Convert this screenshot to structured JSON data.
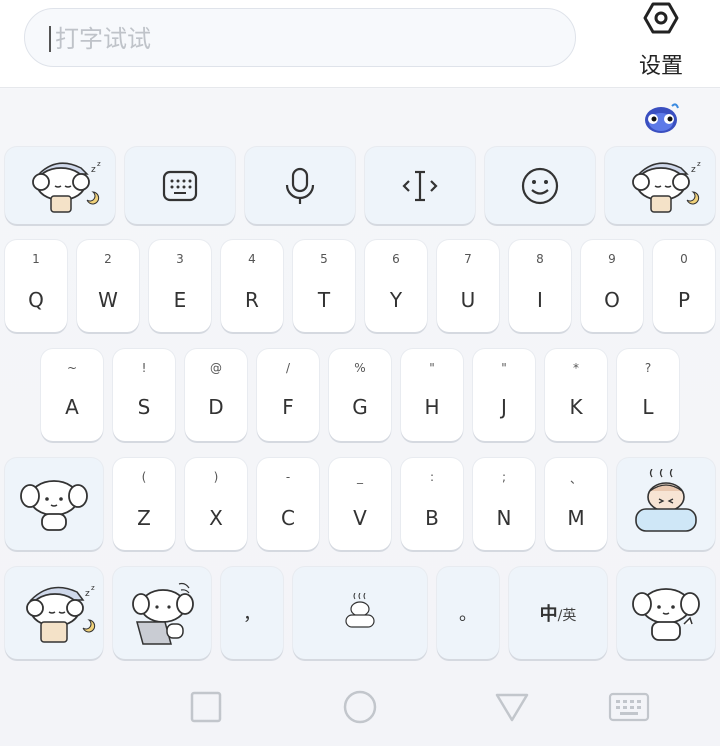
{
  "search": {
    "placeholder": "打字试试"
  },
  "settings": {
    "label": "设置"
  },
  "toolbar": {
    "keys": [
      {
        "name": "keyboard-icon"
      },
      {
        "name": "microphone-icon"
      },
      {
        "name": "cursor-move-icon"
      },
      {
        "name": "emoji-smile-icon"
      }
    ]
  },
  "row1": [
    {
      "sub": "1",
      "main": "Q"
    },
    {
      "sub": "2",
      "main": "W"
    },
    {
      "sub": "3",
      "main": "E"
    },
    {
      "sub": "4",
      "main": "R"
    },
    {
      "sub": "5",
      "main": "T"
    },
    {
      "sub": "6",
      "main": "Y"
    },
    {
      "sub": "7",
      "main": "U"
    },
    {
      "sub": "8",
      "main": "I"
    },
    {
      "sub": "9",
      "main": "O"
    },
    {
      "sub": "0",
      "main": "P"
    }
  ],
  "row2": [
    {
      "sub": "~",
      "main": "A"
    },
    {
      "sub": "!",
      "main": "S"
    },
    {
      "sub": "@",
      "main": "D"
    },
    {
      "sub": "/",
      "main": "F"
    },
    {
      "sub": "%",
      "main": "G"
    },
    {
      "sub": "\"",
      "main": "H"
    },
    {
      "sub": "\"",
      "main": "J"
    },
    {
      "sub": "*",
      "main": "K"
    },
    {
      "sub": "?",
      "main": "L"
    }
  ],
  "row3": [
    {
      "sub": "(",
      "main": "Z"
    },
    {
      "sub": ")",
      "main": "X"
    },
    {
      "sub": "-",
      "main": "C"
    },
    {
      "sub": "_",
      "main": "V"
    },
    {
      "sub": ":",
      "main": "B"
    },
    {
      "sub": ";",
      "main": "N"
    },
    {
      "sub": "、",
      "main": "M"
    }
  ],
  "bottom": {
    "comma": "，",
    "period": "。",
    "lang_zh": "中",
    "lang_sep": "/",
    "lang_en": "英"
  },
  "colors": {
    "key_bg": "#ffffff",
    "func_key_bg": "#eef4fa",
    "keyboard_bg": "#f5f6f9"
  }
}
